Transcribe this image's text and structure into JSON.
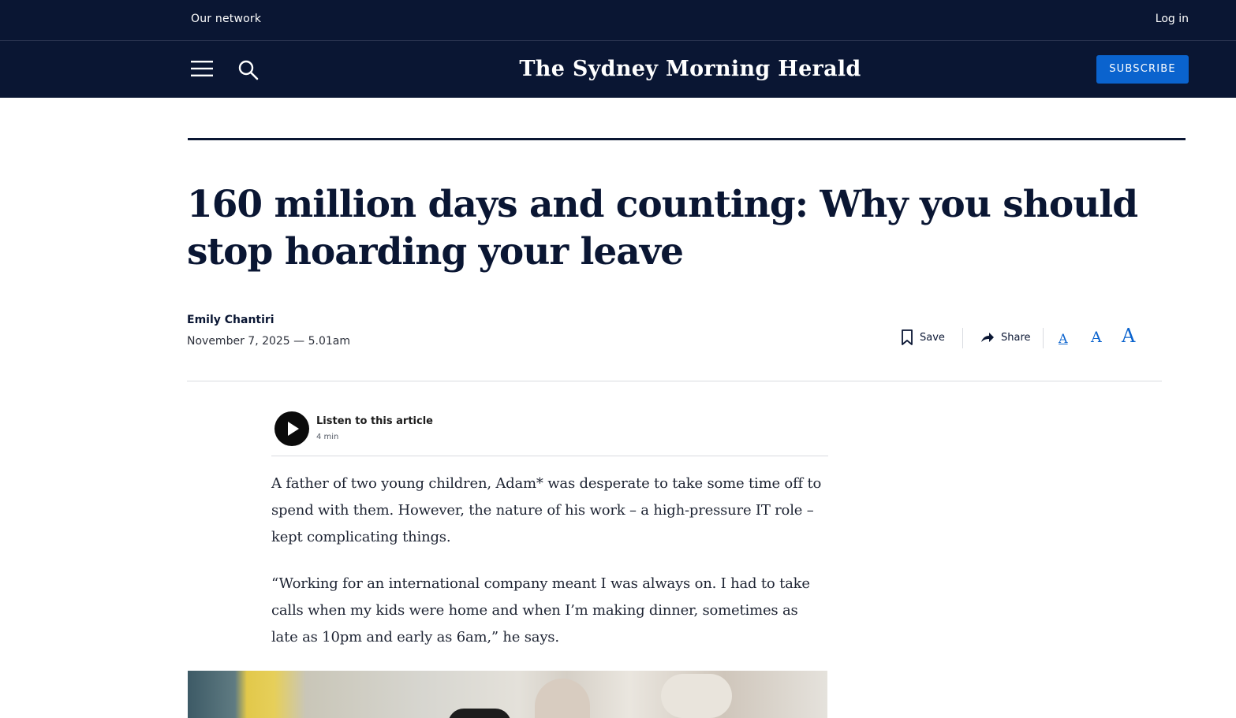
{
  "topbar": {
    "network_label": "Our network",
    "login_label": "Log in"
  },
  "navbar": {
    "masthead": "The Sydney Morning Herald",
    "subscribe_label": "SUBSCRIBE",
    "menu_icon": "hamburger-menu-icon",
    "search_icon": "search-icon"
  },
  "article": {
    "headline": "160 million days and counting: Why you should stop hoarding your leave",
    "author": "Emily Chantiri",
    "date": "November 7, 2025 — 5.01am",
    "tools": {
      "save_label": "Save",
      "share_label": "Share",
      "font_small": "A",
      "font_medium": "A",
      "font_large": "A"
    },
    "listen": {
      "title": "Listen to this article",
      "duration": "4 min"
    },
    "paragraphs": [
      "A father of two young children, Adam* was desperate to take some time off to spend with them. However, the nature of his work – a high-pressure IT role – kept complicating things.",
      "“Working for an international company meant I was always on. I had to take calls when my kids were home and when I’m making dinner, sometimes as late as 10pm and early as 6am,” he says."
    ]
  },
  "colors": {
    "navy": "#0a1633",
    "accent_blue": "#0a63ce"
  }
}
